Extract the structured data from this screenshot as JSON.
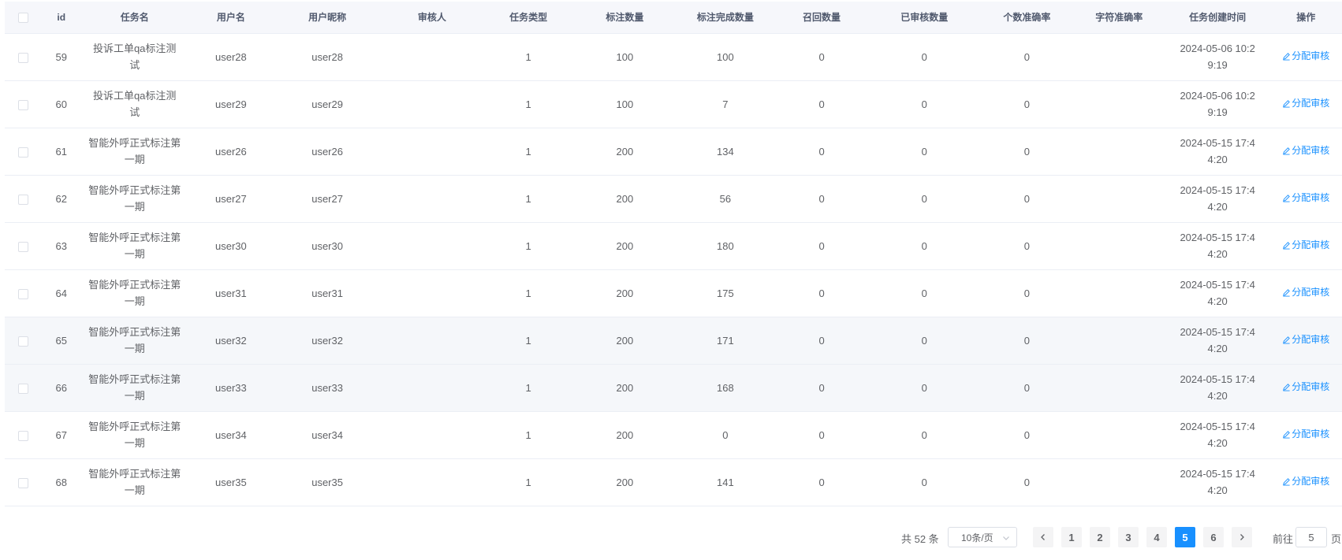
{
  "table": {
    "columns": [
      "",
      "id",
      "任务名",
      "用户名",
      "用户昵称",
      "审核人",
      "任务类型",
      "标注数量",
      "标注完成数量",
      "召回数量",
      "已审核数量",
      "个数准确率",
      "字符准确率",
      "任务创建时间",
      "操作"
    ],
    "rows": [
      {
        "id": "59",
        "task": "投诉工单qa标注测试",
        "user": "user28",
        "nick": "user28",
        "reviewer": "",
        "type": "1",
        "count": "100",
        "done": "100",
        "recall": "0",
        "reviewed": "0",
        "acc_count": "0",
        "acc_char": "",
        "created": "2024-05-06 10:29:19",
        "op": "分配审核"
      },
      {
        "id": "60",
        "task": "投诉工单qa标注测试",
        "user": "user29",
        "nick": "user29",
        "reviewer": "",
        "type": "1",
        "count": "100",
        "done": "7",
        "recall": "0",
        "reviewed": "0",
        "acc_count": "0",
        "acc_char": "",
        "created": "2024-05-06 10:29:19",
        "op": "分配审核"
      },
      {
        "id": "61",
        "task": "智能外呼正式标注第一期",
        "user": "user26",
        "nick": "user26",
        "reviewer": "",
        "type": "1",
        "count": "200",
        "done": "134",
        "recall": "0",
        "reviewed": "0",
        "acc_count": "0",
        "acc_char": "",
        "created": "2024-05-15 17:44:20",
        "op": "分配审核"
      },
      {
        "id": "62",
        "task": "智能外呼正式标注第一期",
        "user": "user27",
        "nick": "user27",
        "reviewer": "",
        "type": "1",
        "count": "200",
        "done": "56",
        "recall": "0",
        "reviewed": "0",
        "acc_count": "0",
        "acc_char": "",
        "created": "2024-05-15 17:44:20",
        "op": "分配审核"
      },
      {
        "id": "63",
        "task": "智能外呼正式标注第一期",
        "user": "user30",
        "nick": "user30",
        "reviewer": "",
        "type": "1",
        "count": "200",
        "done": "180",
        "recall": "0",
        "reviewed": "0",
        "acc_count": "0",
        "acc_char": "",
        "created": "2024-05-15 17:44:20",
        "op": "分配审核"
      },
      {
        "id": "64",
        "task": "智能外呼正式标注第一期",
        "user": "user31",
        "nick": "user31",
        "reviewer": "",
        "type": "1",
        "count": "200",
        "done": "175",
        "recall": "0",
        "reviewed": "0",
        "acc_count": "0",
        "acc_char": "",
        "created": "2024-05-15 17:44:20",
        "op": "分配审核"
      },
      {
        "id": "65",
        "task": "智能外呼正式标注第一期",
        "user": "user32",
        "nick": "user32",
        "reviewer": "",
        "type": "1",
        "count": "200",
        "done": "171",
        "recall": "0",
        "reviewed": "0",
        "acc_count": "0",
        "acc_char": "",
        "created": "2024-05-15 17:44:20",
        "op": "分配审核"
      },
      {
        "id": "66",
        "task": "智能外呼正式标注第一期",
        "user": "user33",
        "nick": "user33",
        "reviewer": "",
        "type": "1",
        "count": "200",
        "done": "168",
        "recall": "0",
        "reviewed": "0",
        "acc_count": "0",
        "acc_char": "",
        "created": "2024-05-15 17:44:20",
        "op": "分配审核"
      },
      {
        "id": "67",
        "task": "智能外呼正式标注第一期",
        "user": "user34",
        "nick": "user34",
        "reviewer": "",
        "type": "1",
        "count": "200",
        "done": "0",
        "recall": "0",
        "reviewed": "0",
        "acc_count": "0",
        "acc_char": "",
        "created": "2024-05-15 17:44:20",
        "op": "分配审核"
      },
      {
        "id": "68",
        "task": "智能外呼正式标注第一期",
        "user": "user35",
        "nick": "user35",
        "reviewer": "",
        "type": "1",
        "count": "200",
        "done": "141",
        "recall": "0",
        "reviewed": "0",
        "acc_count": "0",
        "acc_char": "",
        "created": "2024-05-15 17:44:20",
        "op": "分配审核"
      }
    ],
    "op_icon": "edit-icon",
    "highlight_color": "#f5f7fa"
  },
  "pagination": {
    "total": "共 52 条",
    "page_size": "10条/页",
    "prev_icon": "chevron-left-icon",
    "next_icon": "chevron-right-icon",
    "pages": [
      "1",
      "2",
      "3",
      "4",
      "5",
      "6"
    ],
    "current": "5",
    "goto_label": "前往",
    "goto_value": "5",
    "goto_suffix": "页",
    "accent": "#1890ff"
  }
}
